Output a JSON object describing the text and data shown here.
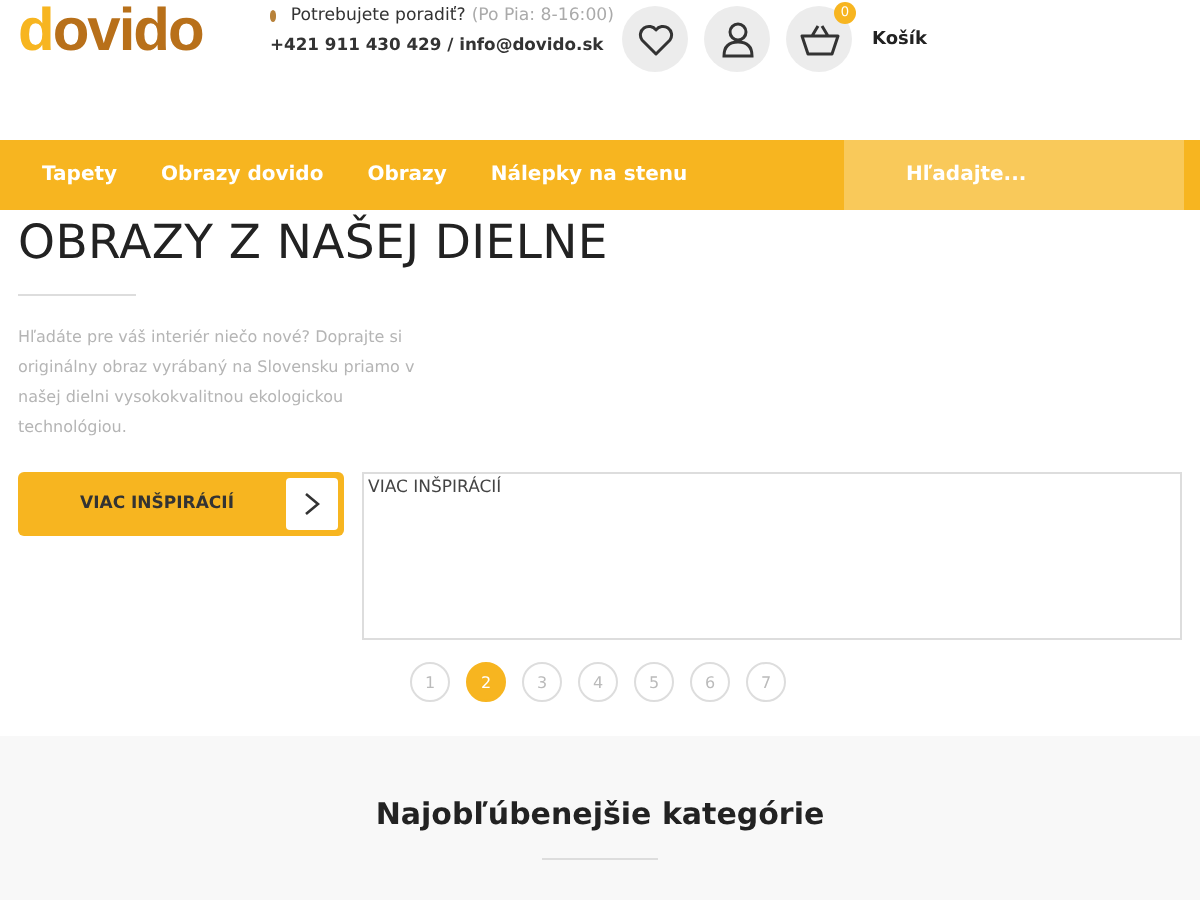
{
  "logo": "dovido",
  "contact": {
    "question": "Potrebujete poradiť?",
    "hours": "(Po Pia: 8-16:00)",
    "line": "+421 911 430 429 / info@dovido.sk"
  },
  "cart": {
    "count": "0",
    "label": "Košík"
  },
  "nav": [
    {
      "label": "Tapety"
    },
    {
      "label": "Obrazy dovido"
    },
    {
      "label": "Obrazy"
    },
    {
      "label": "Nálepky na stenu"
    }
  ],
  "search": {
    "placeholder": "Hľadajte..."
  },
  "heading": "OBRAZY Z NAŠEJ DIELNE",
  "intro": "Hľadáte pre váš interiér niečo nové? Doprajte si originálny obraz vyrábaný na Slovensku priamo v našej dielni vysokokvalitnou ekologickou technológiou.",
  "cta": "VIAC INŠPIRÁCIÍ",
  "textbox": "VIAC INŠPIRÁCIÍ",
  "pages": [
    {
      "label": "1",
      "selected": false
    },
    {
      "label": "2",
      "selected": true
    },
    {
      "label": "3",
      "selected": false
    },
    {
      "label": "4",
      "selected": false
    },
    {
      "label": "5",
      "selected": false
    },
    {
      "label": "6",
      "selected": false
    },
    {
      "label": "7",
      "selected": false
    }
  ],
  "section_title": "Najobľúbenejšie kategórie"
}
